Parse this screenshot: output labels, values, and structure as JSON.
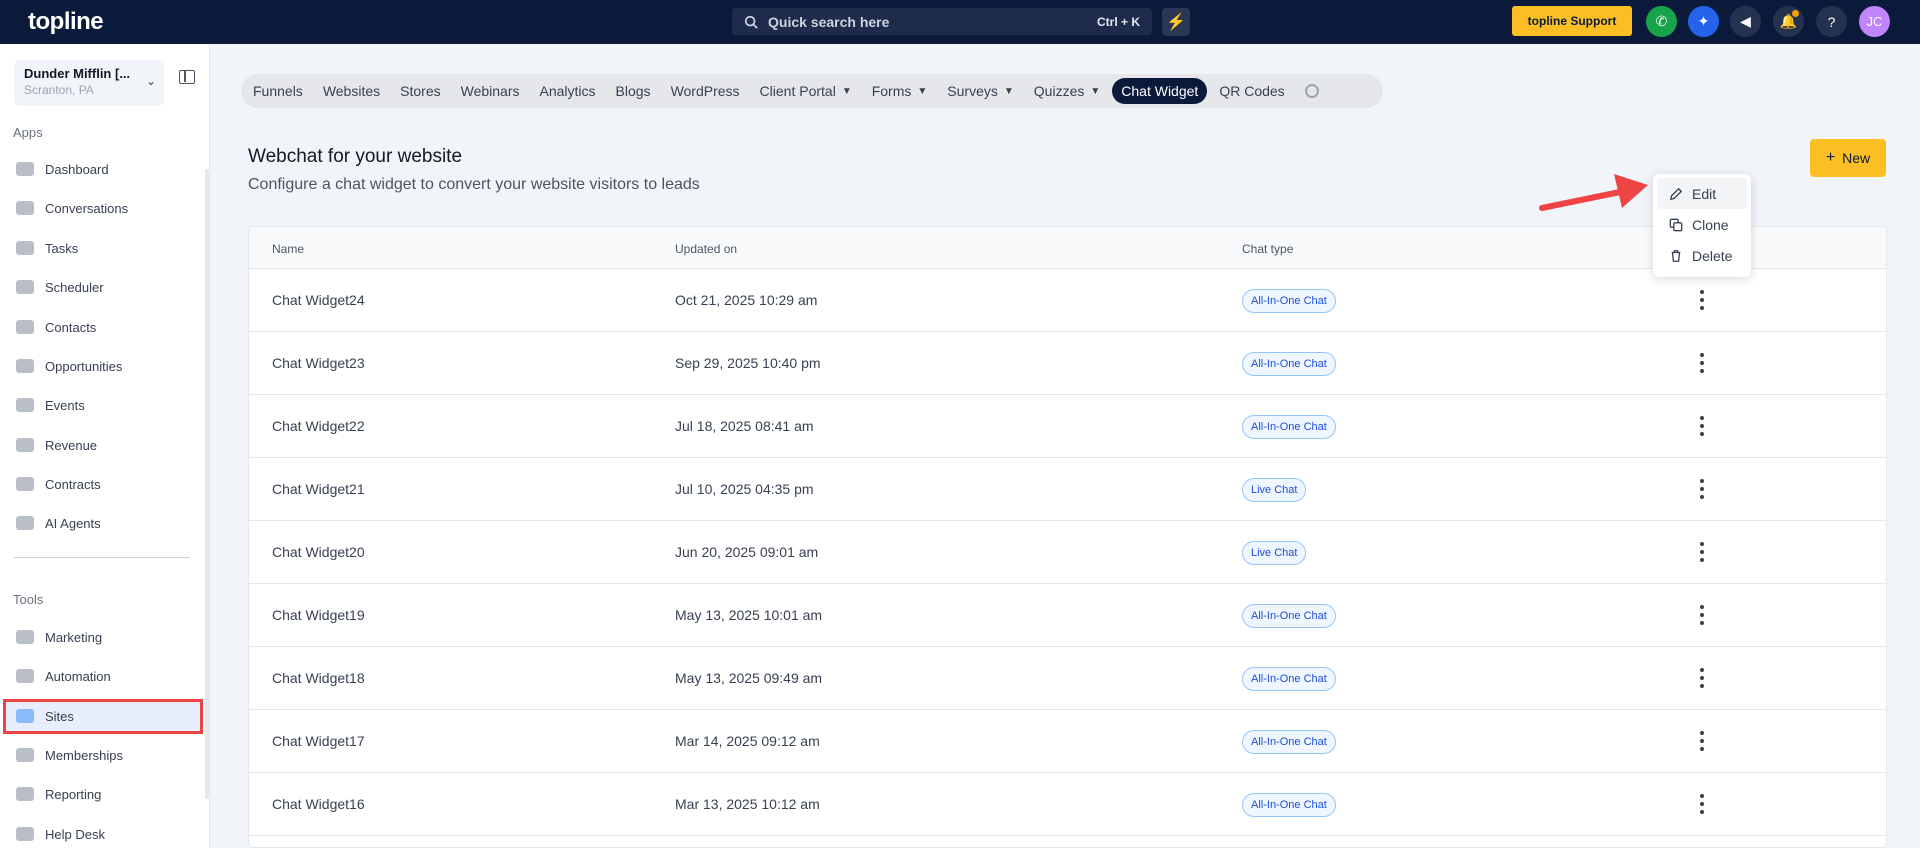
{
  "topbar": {
    "logo": "topline",
    "search_label": "Quick search here",
    "search_shortcut": "Ctrl + K",
    "support_label": "topline Support",
    "avatar_initials": "JC"
  },
  "sidebar": {
    "location_name": "Dunder Mifflin [...",
    "location_city": "Scranton, PA",
    "apps_header": "Apps",
    "tools_header": "Tools",
    "apps": [
      {
        "label": "Dashboard"
      },
      {
        "label": "Conversations"
      },
      {
        "label": "Tasks"
      },
      {
        "label": "Scheduler"
      },
      {
        "label": "Contacts"
      },
      {
        "label": "Opportunities"
      },
      {
        "label": "Events"
      },
      {
        "label": "Revenue"
      },
      {
        "label": "Contracts"
      },
      {
        "label": "AI Agents"
      }
    ],
    "tools": [
      {
        "label": "Marketing"
      },
      {
        "label": "Automation"
      },
      {
        "label": "Sites"
      },
      {
        "label": "Memberships"
      },
      {
        "label": "Reporting"
      },
      {
        "label": "Help Desk"
      }
    ]
  },
  "tabs": [
    {
      "label": "Funnels"
    },
    {
      "label": "Websites"
    },
    {
      "label": "Stores"
    },
    {
      "label": "Webinars"
    },
    {
      "label": "Analytics"
    },
    {
      "label": "Blogs"
    },
    {
      "label": "WordPress"
    },
    {
      "label": "Client Portal"
    },
    {
      "label": "Forms"
    },
    {
      "label": "Surveys"
    },
    {
      "label": "Quizzes"
    },
    {
      "label": "Chat Widget"
    },
    {
      "label": "QR Codes"
    }
  ],
  "header": {
    "title": "Webchat for your website",
    "subtitle": "Configure a chat widget to convert your website visitors to leads",
    "new_label": "New"
  },
  "table": {
    "columns": [
      "Name",
      "Updated on",
      "Chat type"
    ],
    "rows": [
      {
        "name": "Chat Widget24",
        "updated": "Oct 21, 2025 10:29 am",
        "type": "All-In-One Chat"
      },
      {
        "name": "Chat Widget23",
        "updated": "Sep 29, 2025 10:40 pm",
        "type": "All-In-One Chat"
      },
      {
        "name": "Chat Widget22",
        "updated": "Jul 18, 2025 08:41 am",
        "type": "All-In-One Chat"
      },
      {
        "name": "Chat Widget21",
        "updated": "Jul 10, 2025 04:35 pm",
        "type": "Live Chat"
      },
      {
        "name": "Chat Widget20",
        "updated": "Jun 20, 2025 09:01 am",
        "type": "Live Chat"
      },
      {
        "name": "Chat Widget19",
        "updated": "May 13, 2025 10:01 am",
        "type": "All-In-One Chat"
      },
      {
        "name": "Chat Widget18",
        "updated": "May 13, 2025 09:49 am",
        "type": "All-In-One Chat"
      },
      {
        "name": "Chat Widget17",
        "updated": "Mar 14, 2025 09:12 am",
        "type": "All-In-One Chat"
      },
      {
        "name": "Chat Widget16",
        "updated": "Mar 13, 2025 10:12 am",
        "type": "All-In-One Chat"
      }
    ]
  },
  "menu": {
    "items": [
      {
        "label": "Edit"
      },
      {
        "label": "Clone"
      },
      {
        "label": "Delete"
      }
    ]
  },
  "colors": {
    "topbar": "#0b1a3a",
    "accent": "#fbbf24",
    "annotation": "#ef4444",
    "badge_text": "#1d4ed8"
  }
}
